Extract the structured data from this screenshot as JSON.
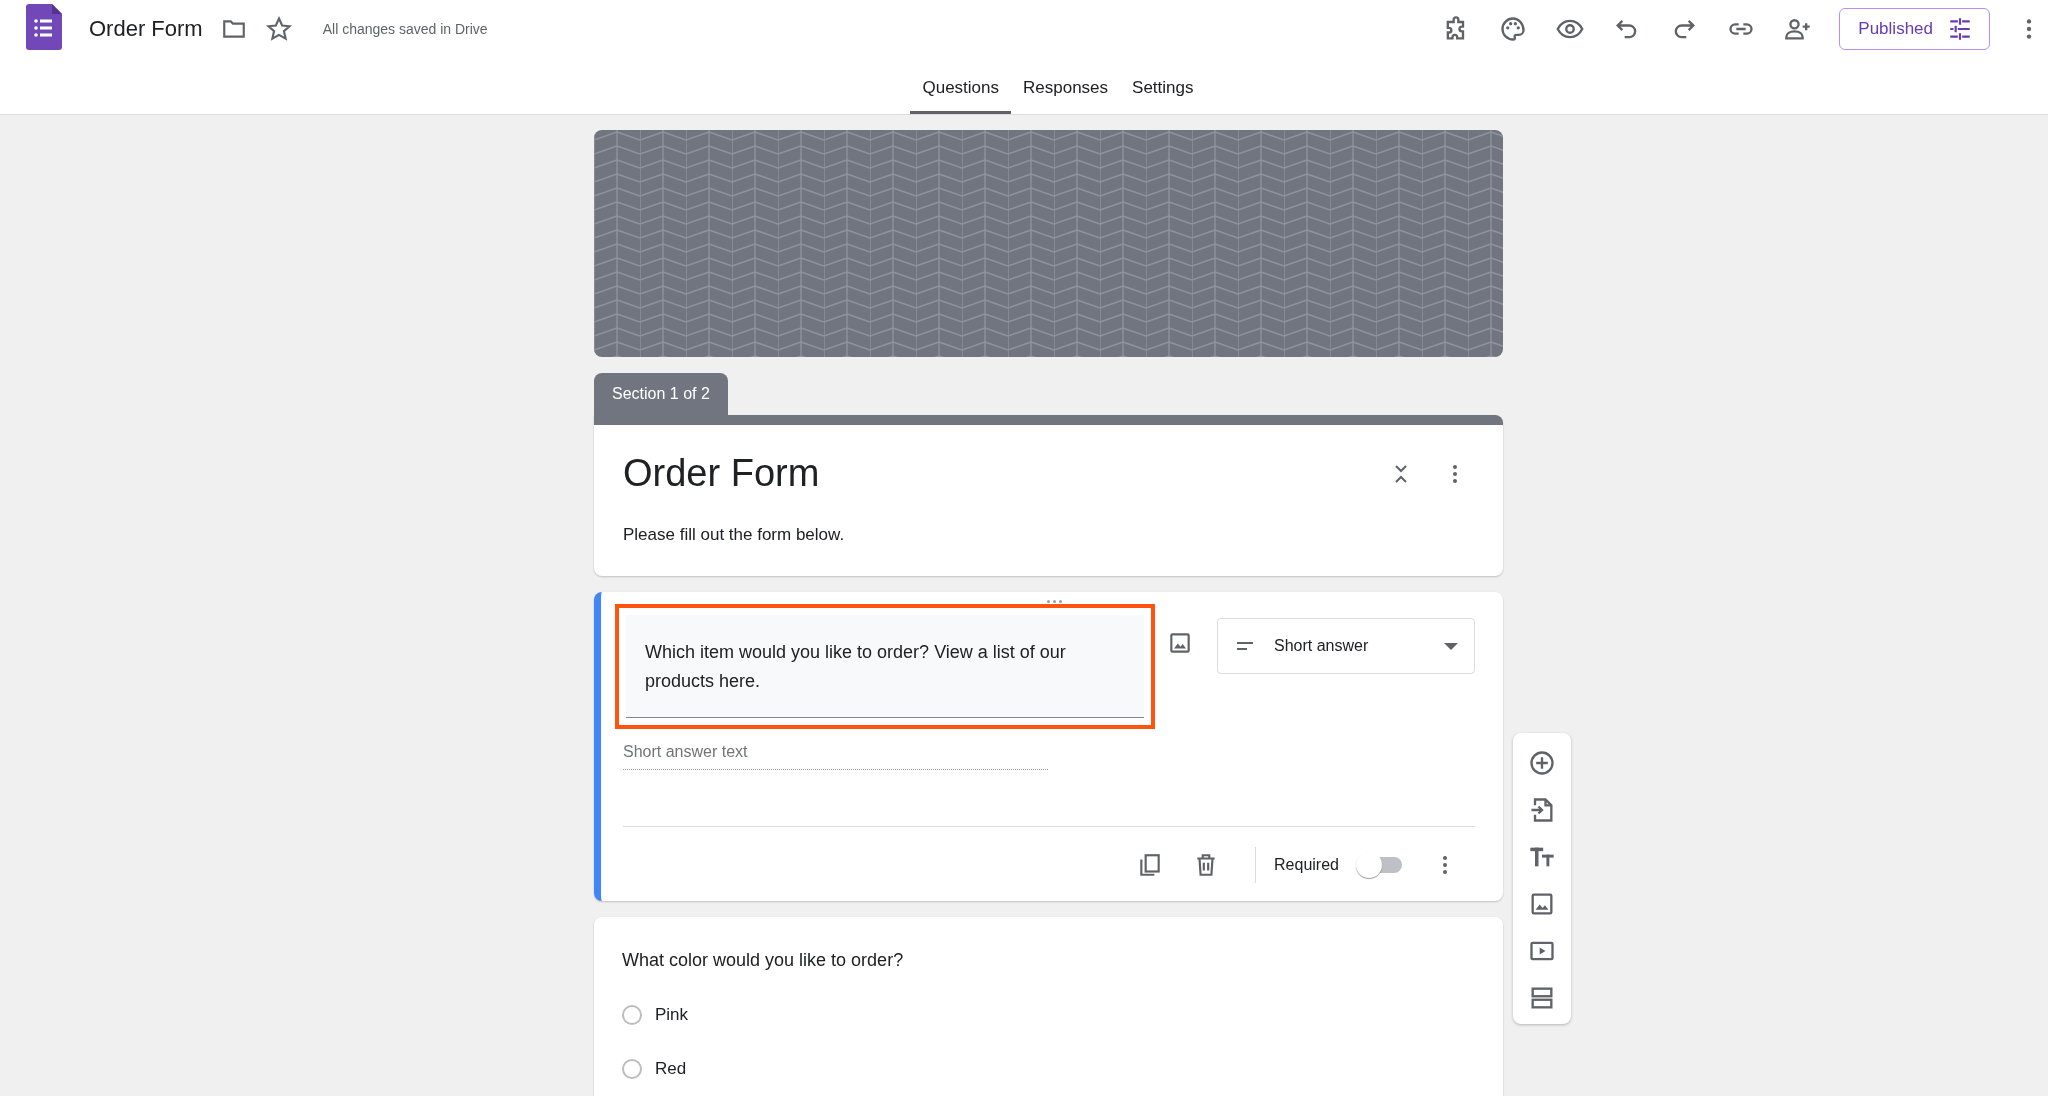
{
  "app": {
    "title": "Order Form",
    "save_status": "All changes saved in Drive",
    "publish_button": "Published"
  },
  "tabs": [
    {
      "label": "Questions",
      "selected": true
    },
    {
      "label": "Responses",
      "selected": false
    },
    {
      "label": "Settings",
      "selected": false
    }
  ],
  "section_tab": "Section 1 of 2",
  "header": {
    "title": "Order Form",
    "description": "Please fill out the form below."
  },
  "questions": [
    {
      "kind": "short_answer",
      "active": true,
      "highlighted": true,
      "title": "Which item would you like to order? View a list of our products here.",
      "type_label": "Short answer",
      "placeholder": "Short answer text",
      "required_label": "Required",
      "required": false
    },
    {
      "kind": "multiple_choice",
      "active": false,
      "title": "What color would you like to order?",
      "options": [
        {
          "label": "Pink",
          "selected": false
        },
        {
          "label": "Red",
          "selected": false
        }
      ]
    }
  ]
}
